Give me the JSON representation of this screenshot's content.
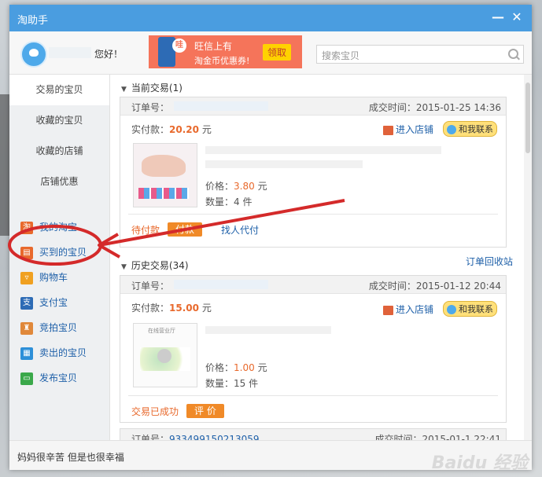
{
  "window": {
    "title": "淘助手",
    "minimize_glyph": "—",
    "close_glyph": "✕"
  },
  "user": {
    "greeting": "您好！"
  },
  "promo": {
    "bubble": "哇",
    "line1": "旺信上有",
    "line2": "淘金币优惠券!",
    "button": "领取"
  },
  "search": {
    "placeholder": "搜索宝贝"
  },
  "sidebar": {
    "tabs": [
      {
        "label": "交易的宝贝"
      },
      {
        "label": "收藏的宝贝"
      },
      {
        "label": "收藏的店铺"
      },
      {
        "label": "店铺优惠"
      }
    ],
    "nav": [
      {
        "label": "我的淘宝",
        "icon": "taobao-icon",
        "color": "#e8692c",
        "glyph": "淘"
      },
      {
        "label": "买到的宝贝",
        "icon": "gift-icon",
        "color": "#e8692c",
        "glyph": "▤"
      },
      {
        "label": "购物车",
        "icon": "cart-icon",
        "color": "#f0a020",
        "glyph": "▿"
      },
      {
        "label": "支付宝",
        "icon": "alipay-icon",
        "color": "#2d6bb5",
        "glyph": "支"
      },
      {
        "label": "竞拍宝贝",
        "icon": "hammer-icon",
        "color": "#e0883a",
        "glyph": "♜"
      },
      {
        "label": "卖出的宝贝",
        "icon": "sold-icon",
        "color": "#2d8fd8",
        "glyph": "▦"
      },
      {
        "label": "发布宝贝",
        "icon": "publish-icon",
        "color": "#3aa84a",
        "glyph": "▭"
      }
    ]
  },
  "current": {
    "header": "当前交易(1)",
    "order_label": "订单号：",
    "time": "成交时间：2015-01-25 14:36",
    "paid_label": "实付款：",
    "paid_amount": "20.20",
    "paid_unit": "元",
    "shop_link": "进入店铺",
    "contact": "和我联系",
    "price_label": "价格：",
    "price": "3.80",
    "price_unit": "元",
    "qty_label": "数量：",
    "qty": "4 件",
    "status": "待付款",
    "pay_button": "付款",
    "proxy": "找人代付"
  },
  "history": {
    "header": "历史交易(34)",
    "recycle": "订单回收站",
    "order_label": "订单号：",
    "time": "成交时间：2015-01-12 20:44",
    "paid_label": "实付款：",
    "paid_amount": "15.00",
    "paid_unit": "元",
    "shop_link": "进入店铺",
    "contact": "和我联系",
    "thumb_text": "在线营业厅",
    "price_label": "价格：",
    "price": "1.00",
    "price_unit": "元",
    "qty_label": "数量：",
    "qty": "15 件",
    "status": "交易已成功",
    "rate_button": "评 价",
    "next_order_label": "订单号：",
    "next_order_no": "933499150213059",
    "next_time": "成交时间：2015-01-1 22:41"
  },
  "footer": {
    "signature": "妈妈很辛苦 但是也很幸福"
  },
  "watermark": "Baidu 经验",
  "annotation_color": "#d42a2a"
}
